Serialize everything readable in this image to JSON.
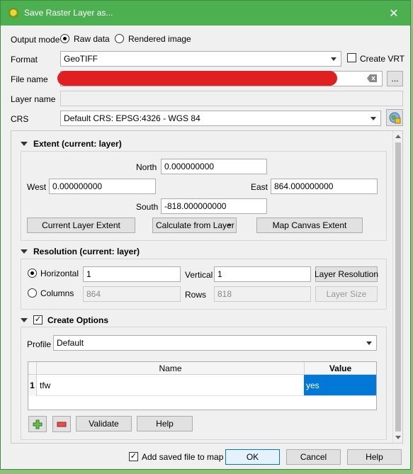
{
  "window": {
    "title": "Save Raster Layer as...",
    "close_glyph": "✕"
  },
  "output_mode": {
    "label": "Output mode",
    "options": [
      "Raw data",
      "Rendered image"
    ],
    "selected": "Raw data"
  },
  "format": {
    "label": "Format",
    "value": "GeoTIFF",
    "create_vrt_label": "Create VRT",
    "create_vrt_checked": false
  },
  "file_name": {
    "label": "File name",
    "value": "",
    "browse_label": "..."
  },
  "layer_name": {
    "label": "Layer name",
    "value": ""
  },
  "crs": {
    "label": "CRS",
    "value": "Default CRS: EPSG:4326 - WGS 84"
  },
  "extent": {
    "header": "Extent (current: layer)",
    "north_label": "North",
    "north": "0.000000000",
    "west_label": "West",
    "west": "0.000000000",
    "east_label": "East",
    "east": "864.000000000",
    "south_label": "South",
    "south": "-818.000000000",
    "current_layer_extent": "Current Layer Extent",
    "calculate_from_layer": "Calculate from Layer",
    "map_canvas_extent": "Map Canvas Extent"
  },
  "resolution": {
    "header": "Resolution (current: layer)",
    "horizontal_label": "Horizontal",
    "horizontal": "1",
    "vertical_label": "Vertical",
    "vertical": "1",
    "layer_resolution": "Layer Resolution",
    "columns_label": "Columns",
    "columns": "864",
    "rows_label": "Rows",
    "rows": "818",
    "layer_size": "Layer Size",
    "selected": "Horizontal"
  },
  "create_options": {
    "header": "Create Options",
    "checked": true,
    "profile_label": "Profile",
    "profile": "Default",
    "table_headers": [
      "Name",
      "Value"
    ],
    "rows": [
      {
        "index": "1",
        "name": "tfw",
        "value": "yes"
      }
    ],
    "validate_label": "Validate",
    "help_label": "Help"
  },
  "footer": {
    "add_saved_file_label": "Add saved file to map",
    "add_saved_file_checked": true,
    "ok": "OK",
    "cancel": "Cancel",
    "help": "Help"
  },
  "colors": {
    "titlebar": "#4caf50",
    "selection": "#0078d7",
    "redaction": "#e02020"
  },
  "icons": [
    "qgis-logo-icon",
    "close-icon",
    "clear-icon",
    "crs-globe-icon",
    "add-icon",
    "remove-icon"
  ]
}
